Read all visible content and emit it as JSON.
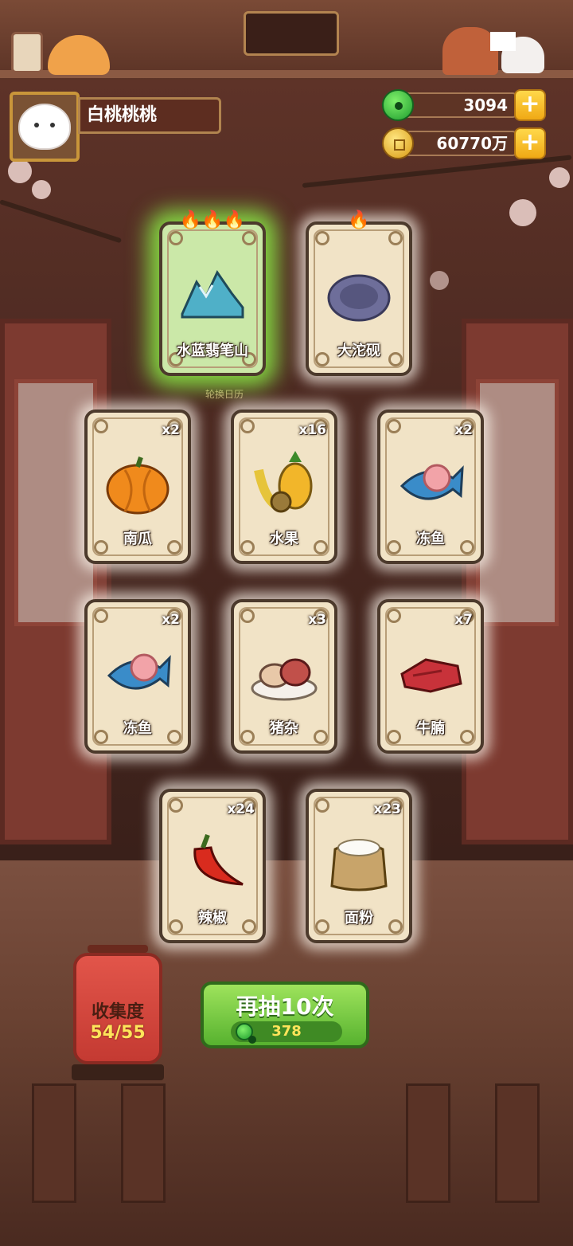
{
  "player": {
    "name": "白桃桃桃"
  },
  "currencies": {
    "jade": {
      "value": "3094",
      "icon": "jade-icon"
    },
    "coins": {
      "value": "60770万",
      "icon": "coin-icon"
    }
  },
  "hint_text": "轮换日历",
  "cards": [
    {
      "name": "水蓝翡笔山",
      "count": "",
      "flames": "🔥🔥🔥",
      "rarity": "green",
      "icon": "mountain-icon",
      "color": "#4fb0c8"
    },
    {
      "name": "大沱砚",
      "count": "",
      "flames": "🔥",
      "rarity": "normal",
      "icon": "inkstone-icon",
      "color": "#6e6e9a"
    },
    {
      "name": "南瓜",
      "count": "x2",
      "flames": "",
      "rarity": "normal",
      "icon": "pumpkin-icon",
      "color": "#f08a1c"
    },
    {
      "name": "水果",
      "count": "x16",
      "flames": "",
      "rarity": "normal",
      "icon": "fruit-icon",
      "color": "#f2b62a"
    },
    {
      "name": "冻鱼",
      "count": "x2",
      "flames": "",
      "rarity": "normal",
      "icon": "fish-icon",
      "color": "#3a8cc9"
    },
    {
      "name": "冻鱼",
      "count": "x2",
      "flames": "",
      "rarity": "normal",
      "icon": "fish-icon",
      "color": "#3a8cc9"
    },
    {
      "name": "猪杂",
      "count": "x3",
      "flames": "",
      "rarity": "normal",
      "icon": "offal-icon",
      "color": "#c1504a"
    },
    {
      "name": "牛腩",
      "count": "x7",
      "flames": "",
      "rarity": "normal",
      "icon": "beef-icon",
      "color": "#c8323a"
    },
    {
      "name": "辣椒",
      "count": "x24",
      "flames": "",
      "rarity": "normal",
      "icon": "chili-icon",
      "color": "#d92b1e"
    },
    {
      "name": "面粉",
      "count": "x23",
      "flames": "",
      "rarity": "normal",
      "icon": "flour-sack-icon",
      "color": "#c8a46a"
    }
  ],
  "collection": {
    "label": "收集度",
    "progress": "54/55"
  },
  "draw_button": {
    "label": "再抽10次",
    "cost": "378",
    "cost_icon": "jade-icon"
  }
}
